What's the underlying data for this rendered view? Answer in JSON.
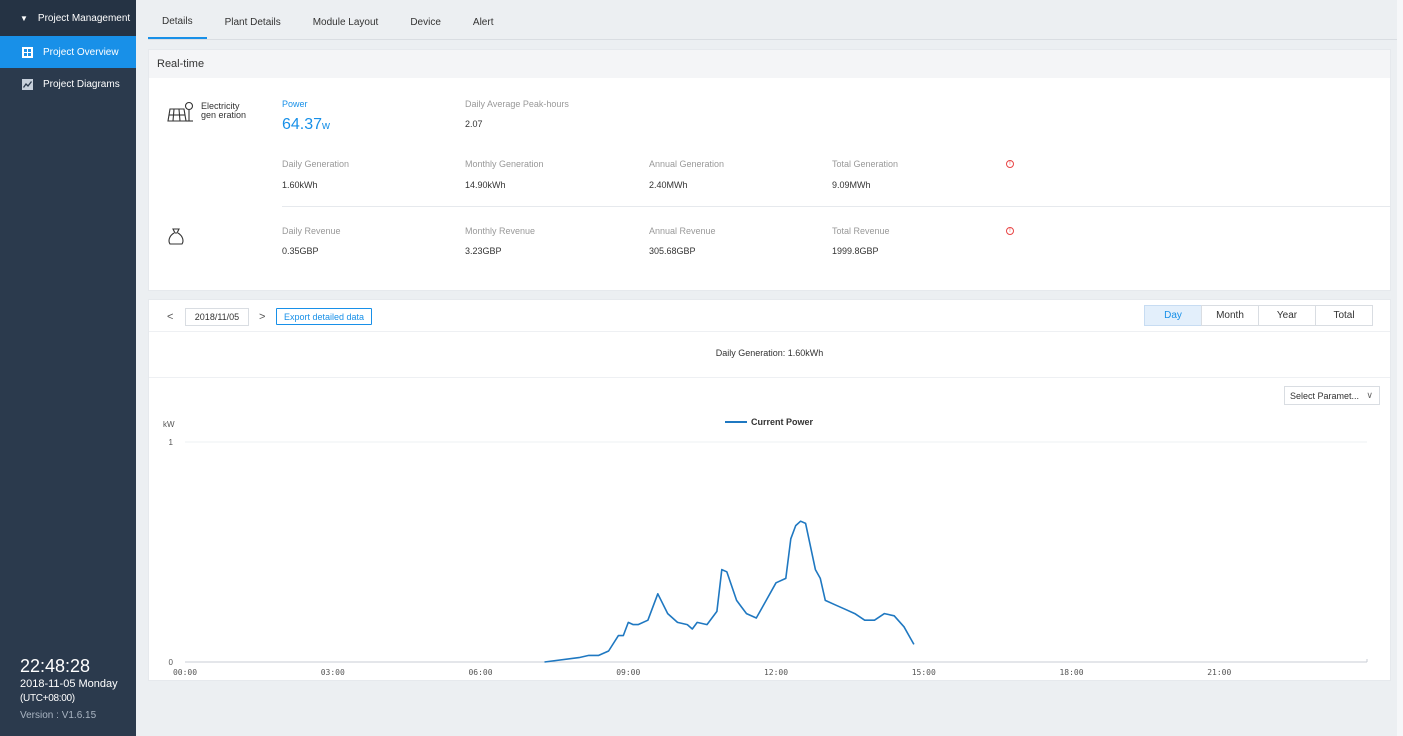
{
  "sidebar": {
    "header": "Project Management",
    "items": [
      {
        "label": "Project Overview",
        "icon": "grid-icon",
        "active": true
      },
      {
        "label": "Project Diagrams",
        "icon": "chart-icon",
        "active": false
      }
    ],
    "time": "22:48:28",
    "date": "2018-11-05 Monday",
    "timezone": "(UTC+08:00)",
    "version": "Version :  V1.6.15"
  },
  "tabs": [
    "Details",
    "Plant Details",
    "Module Layout",
    "Device",
    "Alert"
  ],
  "realtime": {
    "title": "Real-time",
    "generation_label": "Electricity gen eration",
    "power_label": "Power",
    "power_value": "64.37",
    "power_unit": "w",
    "peak_label": "Daily Average Peak-hours",
    "peak_value": "2.07",
    "daily_gen_label": "Daily Generation",
    "daily_gen_value": "1.60kWh",
    "monthly_gen_label": "Monthly Generation",
    "monthly_gen_value": "14.90kWh",
    "annual_gen_label": "Annual Generation",
    "annual_gen_value": "2.40MWh",
    "total_gen_label": "Total Generation",
    "total_gen_value": "9.09MWh",
    "daily_rev_label": "Daily Revenue",
    "daily_rev_value": "0.35GBP",
    "monthly_rev_label": "Monthly Revenue",
    "monthly_rev_value": "3.23GBP",
    "annual_rev_label": "Annual Revenue",
    "annual_rev_value": "305.68GBP",
    "total_rev_label": "Total Revenue",
    "total_rev_value": "1999.8GBP"
  },
  "chart_controls": {
    "prev": "<",
    "next": ">",
    "date": "2018/11/05",
    "export": "Export detailed data",
    "periods": [
      "Day",
      "Month",
      "Year",
      "Total"
    ],
    "active_period": "Day",
    "daily_generation": "Daily Generation: 1.60kWh",
    "select_param": "Select Paramet...",
    "select_chevron": "∨"
  },
  "colors": {
    "accent": "#1890e8",
    "sidebar": "#2b3a4d",
    "warning": "#e84646"
  },
  "chart_data": {
    "type": "line",
    "ylabel": "kW",
    "ylim": [
      0,
      1
    ],
    "yticks": [
      "0",
      "1"
    ],
    "xlim": [
      0,
      24
    ],
    "xticks": [
      "00:00",
      "03:00",
      "06:00",
      "09:00",
      "12:00",
      "15:00",
      "18:00",
      "21:00"
    ],
    "legend": "top-center",
    "grid": true,
    "series": [
      {
        "name": "Current Power",
        "color": "#1f78c1",
        "x": [
          7.3,
          8.0,
          8.2,
          8.4,
          8.6,
          8.8,
          8.9,
          9.0,
          9.1,
          9.2,
          9.4,
          9.6,
          9.8,
          10.0,
          10.2,
          10.3,
          10.4,
          10.6,
          10.8,
          10.9,
          11.0,
          11.2,
          11.3,
          11.4,
          11.6,
          11.8,
          12.0,
          12.2,
          12.3,
          12.4,
          12.5,
          12.6,
          12.8,
          12.9,
          13.0,
          13.2,
          13.4,
          13.6,
          13.8,
          14.0,
          14.2,
          14.4,
          14.6,
          14.8
        ],
        "y": [
          0.0,
          0.02,
          0.03,
          0.03,
          0.05,
          0.12,
          0.12,
          0.18,
          0.17,
          0.17,
          0.19,
          0.31,
          0.22,
          0.18,
          0.17,
          0.15,
          0.18,
          0.17,
          0.23,
          0.42,
          0.41,
          0.28,
          0.25,
          0.22,
          0.2,
          0.28,
          0.36,
          0.38,
          0.56,
          0.62,
          0.64,
          0.63,
          0.42,
          0.38,
          0.28,
          0.26,
          0.24,
          0.22,
          0.19,
          0.19,
          0.22,
          0.21,
          0.16,
          0.08
        ]
      }
    ]
  }
}
